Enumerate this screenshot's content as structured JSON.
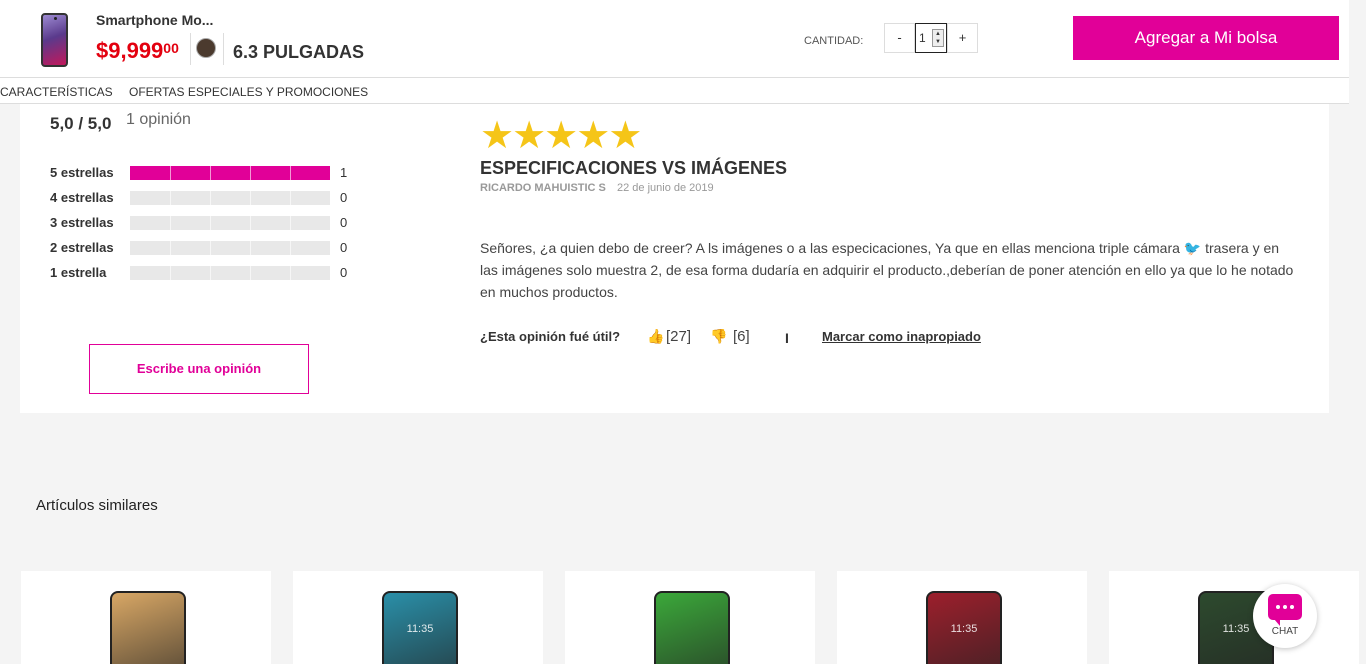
{
  "header": {
    "product_name": "Smartphone Mo...",
    "price_main": "$9,999",
    "price_cents": "00",
    "color_swatch": "#4b3a2e",
    "size": "6.3 PULGADAS",
    "quantity_label": "CANTIDAD:",
    "qty_minus": "-",
    "qty_value": "1",
    "qty_plus": "+",
    "add_button": "Agregar a Mi bolsa"
  },
  "tabs": [
    "CARACTERÍSTICAS",
    "OFERTAS ESPECIALES Y PROMOCIONES"
  ],
  "summary": {
    "average": "5,0 / 5,0",
    "count": "1 opinión",
    "distribution": [
      {
        "label": "5 estrellas",
        "count": "1",
        "fill": 1.0
      },
      {
        "label": "4 estrellas",
        "count": "0",
        "fill": 0
      },
      {
        "label": "3 estrellas",
        "count": "0",
        "fill": 0
      },
      {
        "label": "2 estrellas",
        "count": "0",
        "fill": 0
      },
      {
        "label": "1 estrella",
        "count": "0",
        "fill": 0
      }
    ],
    "write_button": "Escribe una opinión"
  },
  "review": {
    "rating": 5,
    "title": "ESPECIFICACIONES VS IMÁGENES",
    "author": "RICARDO MAHUISTIC S",
    "date": "22 de junio de 2019",
    "body": "Señores, ¿a quien debo de creer? A ls imágenes o a las especicaciones, Ya que en ellas menciona triple cámara 🐦 trasera y en las imágenes solo muestra 2, de esa forma dudaría en adquirir el producto.,deberían de poner atención en ello ya que lo he notado en muchos productos.",
    "helpful_question": "¿Esta opinión fué útil?",
    "up_count": "[27]",
    "down_count": "[6]",
    "separator": "I",
    "flag_link": "Marcar como inapropiado"
  },
  "similar": {
    "title": "Artículos similares",
    "phone_screens": [
      "#d8a765",
      "#2a8fa8",
      "#3ba83a",
      "#9c1f2c",
      "#2d4a2e"
    ],
    "clocks": [
      "",
      "11:35",
      "",
      "11:35",
      "11:35"
    ]
  },
  "chat": {
    "label": "CHAT"
  },
  "colors": {
    "accent": "#e10098",
    "price": "#e3000f",
    "star": "#f5c518"
  }
}
